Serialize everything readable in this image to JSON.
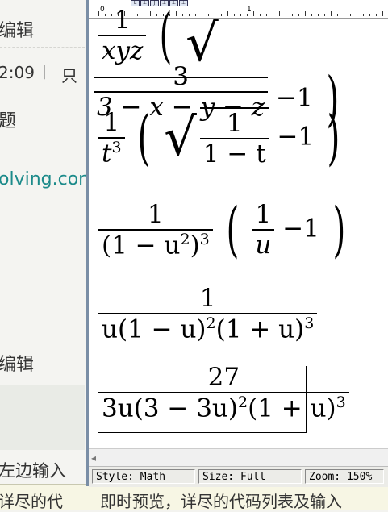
{
  "background_page": {
    "edit_label_1": "编辑",
    "timestamp": "2:09",
    "separator": "|",
    "readonly_text": "只",
    "topic_label": "题",
    "link_text": "olving.cor",
    "edit_label_2": "编辑",
    "bottom_left_line1": "左边输入",
    "bottom_left_line2": "详尽的代",
    "bottom_text": "即时预览，详尽的代码列表及输入"
  },
  "ruler": {
    "label_0": "0",
    "label_1": "1"
  },
  "equations": {
    "eq1": {
      "num": "1",
      "den": "xyz",
      "inner_num": "3",
      "inner_den": "3 − x − y − z",
      "tail": "−1"
    },
    "eq2": {
      "num": "1",
      "den_base": "t",
      "den_exp": "3",
      "inner_num": "1",
      "inner_den": "1 − t",
      "tail": "−1"
    },
    "eq3": {
      "num": "1",
      "den": "(1 − u",
      "den_exp_inner": "2",
      "den_close": ")",
      "den_exp": "3",
      "inner_num": "1",
      "inner_den": "u",
      "tail": "−1"
    },
    "eq4": {
      "num": "1",
      "den_a": "u(1 − u)",
      "den_a_exp": "2",
      "den_b": "(1 + u)",
      "den_b_exp": "3"
    },
    "eq5": {
      "num": "27",
      "den_a": "3u(3 − 3u)",
      "den_a_exp": "2",
      "den_b": "(1 + u)",
      "den_b_exp": "3"
    }
  },
  "status": {
    "style": "Style: Math",
    "size": "Size: Full",
    "zoom": "Zoom: 150%"
  }
}
